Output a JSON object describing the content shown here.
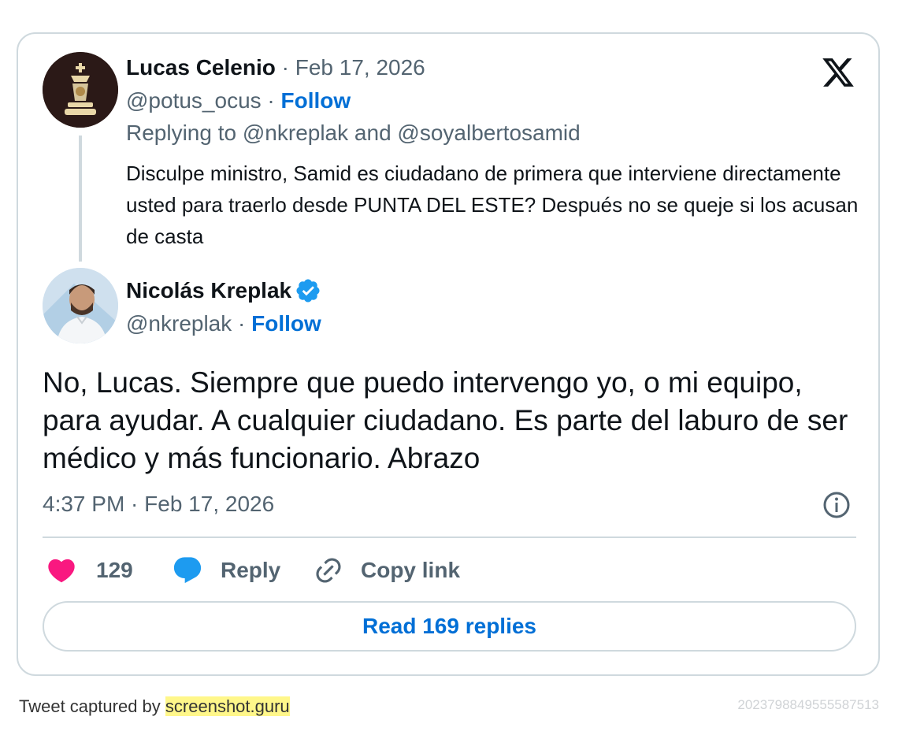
{
  "parent_tweet": {
    "author_name": "Lucas Celenio",
    "date": "Feb 17, 2026",
    "handle": "@potus_ocus",
    "follow_label": "Follow",
    "replying_prefix": "Replying to",
    "replying_user_1": "@nkreplak",
    "replying_joiner": "and",
    "replying_user_2": "@soyalbertosamid",
    "text": "Disculpe ministro, Samid es ciudadano de primera que interviene directamente usted para traerlo desde PUNTA DEL ESTE? Después no se queje si los acusan de casta"
  },
  "main_tweet": {
    "author_name": "Nicolás Kreplak",
    "verified": true,
    "handle": "@nkreplak",
    "follow_label": "Follow",
    "text": "No, Lucas. Siempre que puedo intervengo yo, o mi equipo, para ayudar. A cualquier ciudadano. Es parte del laburo de ser médico y más funcionario. Abrazo",
    "timestamp": "4:37 PM · Feb 17, 2026"
  },
  "actions": {
    "like_count": "129",
    "reply_label": "Reply",
    "copy_link_label": "Copy link",
    "read_replies_label": "Read 169 replies"
  },
  "footer": {
    "captured_prefix": "Tweet captured by",
    "captured_site": "screenshot.guru",
    "tweet_id": "2023798849555587513"
  },
  "icons": {
    "brand": "x-logo-icon",
    "verified": "verified-badge-icon",
    "info": "info-icon",
    "like": "heart-icon",
    "reply": "speech-bubble-icon",
    "copy_link": "link-icon"
  },
  "colors": {
    "link_blue": "#006fd6",
    "muted_gray": "#536471",
    "heart_pink": "#f91880",
    "reply_blue": "#1d9bf0",
    "border": "#cfd9de"
  }
}
